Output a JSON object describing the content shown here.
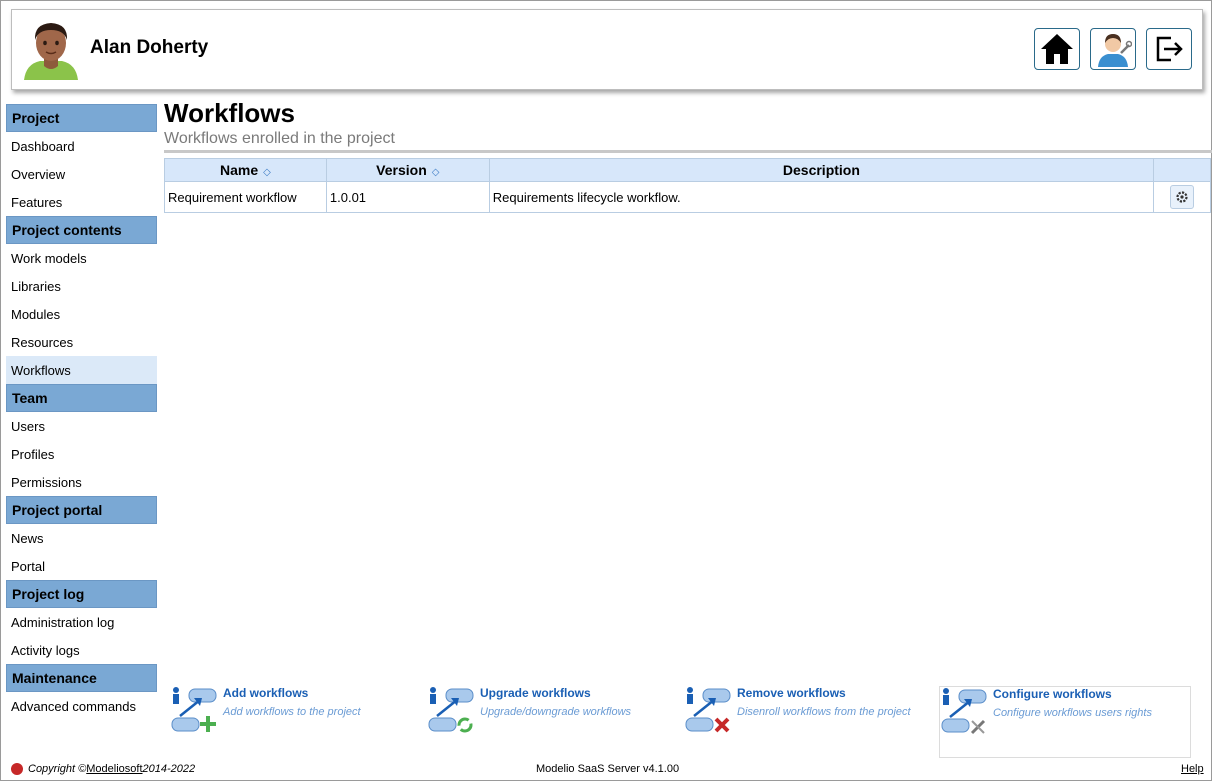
{
  "header": {
    "user_name": "Alan Doherty",
    "buttons": [
      {
        "name": "home-button",
        "icon": "home-icon"
      },
      {
        "name": "user-settings-button",
        "icon": "user-tools-icon"
      },
      {
        "name": "logout-button",
        "icon": "logout-icon"
      }
    ]
  },
  "sidebar": {
    "sections": [
      {
        "title": "Project",
        "items": [
          "Dashboard",
          "Overview",
          "Features"
        ]
      },
      {
        "title": "Project contents",
        "items": [
          "Work models",
          "Libraries",
          "Modules",
          "Resources",
          "Workflows"
        ]
      },
      {
        "title": "Team",
        "items": [
          "Users",
          "Profiles",
          "Permissions"
        ]
      },
      {
        "title": "Project portal",
        "items": [
          "News",
          "Portal"
        ]
      },
      {
        "title": "Project log",
        "items": [
          "Administration log",
          "Activity logs"
        ]
      },
      {
        "title": "Maintenance",
        "items": [
          "Advanced commands"
        ]
      }
    ],
    "active_item": "Workflows"
  },
  "main": {
    "title": "Workflows",
    "subtitle": "Workflows enrolled in the project",
    "table": {
      "headers": [
        "Name",
        "Version",
        "Description"
      ],
      "rows": [
        {
          "name": "Requirement workflow",
          "version": "1.0.01",
          "description": "Requirements lifecycle workflow."
        }
      ]
    }
  },
  "actions": [
    {
      "title": "Add workflows",
      "desc": "Add workflows to the project",
      "icon": "add-workflow-icon"
    },
    {
      "title": "Upgrade workflows",
      "desc": "Upgrade/downgrade workflows",
      "icon": "upgrade-workflow-icon"
    },
    {
      "title": "Remove workflows",
      "desc": "Disenroll workflows from the project",
      "icon": "remove-workflow-icon"
    },
    {
      "title": "Configure workflows",
      "desc": "Configure workflows users rights",
      "icon": "configure-workflow-icon"
    }
  ],
  "footer": {
    "copyright_prefix": "Copyright ©",
    "company": "Modeliosoft",
    "years": " 2014-2022",
    "version": "Modelio SaaS Server v4.1.00",
    "help": "Help"
  },
  "colors": {
    "section_header": "#7aa8d4",
    "table_header": "#d7e7fa",
    "link": "#1a5fb4"
  }
}
